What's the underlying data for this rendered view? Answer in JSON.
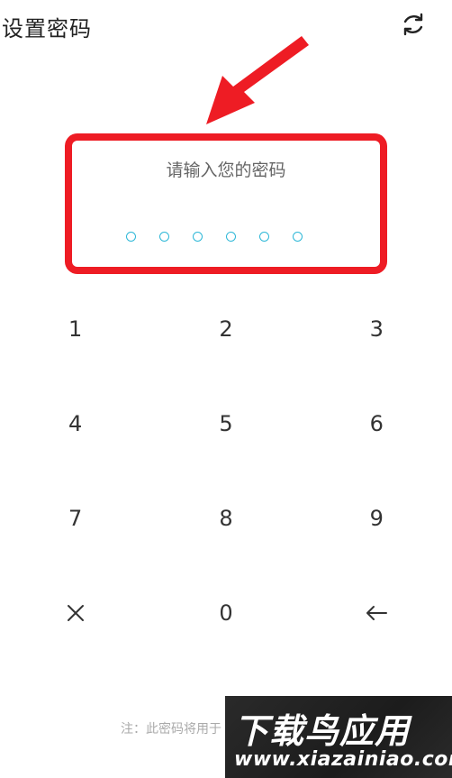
{
  "header": {
    "title": "设置密码",
    "refresh_icon": "refresh-icon"
  },
  "password_box": {
    "prompt": "请输入您的密码",
    "digits_total": 6,
    "digits_entered": 0
  },
  "keypad": {
    "keys": [
      "1",
      "2",
      "3",
      "4",
      "5",
      "6",
      "7",
      "8",
      "9",
      "clear",
      "0",
      "backspace"
    ],
    "labels": {
      "k1": "1",
      "k2": "2",
      "k3": "3",
      "k4": "4",
      "k5": "5",
      "k6": "6",
      "k7": "7",
      "k8": "8",
      "k9": "9",
      "k0": "0"
    }
  },
  "footer": {
    "note": "注：此密码将用于"
  },
  "watermark": {
    "line1": "下载鸟应用",
    "line2": "www.xiazainiao.com"
  },
  "colors": {
    "highlight": "#ee1c24",
    "dot": "#2cb7d7"
  }
}
